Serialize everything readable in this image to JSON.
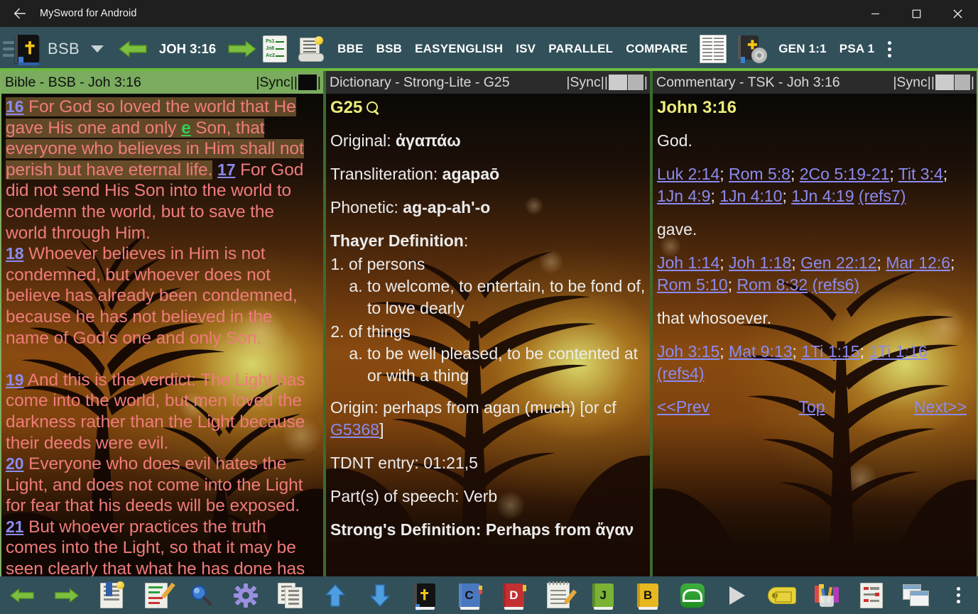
{
  "window": {
    "title": "MySword for Android",
    "back_icon": "back-arrow-icon",
    "minimize": "—",
    "maximize": "☐",
    "close": "✕"
  },
  "toolbar": {
    "module_label": "BSB",
    "dropdown_icon": "chevron-down-icon",
    "menu_icon": "hamburger-icon",
    "bible_icon": "bible-book-icon",
    "prev_icon": "left-green-arrow-icon",
    "next_icon": "right-green-arrow-icon",
    "reference": "JOH 3:16",
    "reading_plan_icon": "reading-plan-icon",
    "plan_rows": [
      {
        "label": "Ps1"
      },
      {
        "label": "Jn8"
      },
      {
        "label": "Ac2"
      }
    ],
    "cross_ref_icon": "linked-note-icon",
    "versions": [
      "BBE",
      "BSB",
      "EASYENGLISH",
      "ISV",
      "PARALLEL",
      "COMPARE"
    ],
    "parallel_view_icon": "parallel-columns-icon",
    "module_settings_icon": "book-gear-icon",
    "bookmark_left": "GEN 1:1",
    "bookmark_right": "PSA 1",
    "overflow_icon": "kebab-menu-icon"
  },
  "panels": {
    "bible": {
      "header_title": "Bible - BSB - Joh 3:16",
      "header_sync": "|Sync||",
      "header_sync_end": "|",
      "verses": [
        {
          "num": "16",
          "text": "For God so loved the world that He gave His one and only ",
          "strongs": "e",
          "text2": " Son, that everyone who believes in Him shall not perish but have eternal life.",
          "highlighted": true
        },
        {
          "num": "17",
          "text": "For God did not send His Son into the world to condemn the world, but to save the world through Him.",
          "highlighted": false
        },
        {
          "num": "18",
          "text": "Whoever believes in Him is not condemned, but whoever does not believe has already been condemned, because he has not believed in the name of God’s one and only Son.",
          "highlighted": false
        },
        {
          "num": "19",
          "text": "And this is the verdict: The Light has come into the world, but men loved the darkness rather than the Light because their deeds were evil.",
          "highlighted": false
        },
        {
          "num": "20",
          "text": "Everyone who does evil hates the Light, and does not come into the Light for fear that his deeds will be exposed.",
          "highlighted": false
        },
        {
          "num": "21",
          "text": "But whoever practices the truth comes into the Light, so that it may be seen clearly that what he has done has",
          "highlighted": false
        }
      ]
    },
    "dictionary": {
      "header_title": "Dictionary - Strong-Lite - G25",
      "header_sync": "|Sync||",
      "header_sync_end": "|",
      "entry_title": "G25",
      "search_icon": "magnifier-icon",
      "original_label": "Original:",
      "original_value": "ἀγαπάω",
      "translit_label": "Transliteration:",
      "translit_value": "agapaō",
      "phonetic_label": "Phonetic:",
      "phonetic_value": "ag-ap-ah'-o",
      "thayer_label": "Thayer Definition",
      "thayer_colon": ":",
      "thayer": [
        {
          "n": "of persons",
          "sub": [
            "to welcome, to entertain, to be fond of, to love dearly"
          ]
        },
        {
          "n": "of things",
          "sub": [
            "to be well pleased, to be contented at or with a thing"
          ]
        }
      ],
      "origin_pre": "Origin: perhaps from agan (much) [or cf ",
      "origin_link": "G5368",
      "origin_post": "]",
      "tdnt": "TDNT entry: 01:21,5",
      "pos": "Part(s) of speech: Verb",
      "strongs_def_cut": "Strong's Definition: Perhaps from ἄγαν"
    },
    "commentary": {
      "header_title": "Commentary - TSK - Joh 3:16",
      "header_sync": "|Sync||",
      "header_sync_end": "|",
      "entry_title": "John 3:16",
      "blocks": [
        {
          "phrase": "God.",
          "refs": [
            "Luk 2:14",
            "Rom 5:8",
            "2Co 5:19-21",
            "Tit 3:4",
            "1Jn 4:9",
            "1Jn 4:10",
            "1Jn 4:19"
          ],
          "refs_count": "(refs7)"
        },
        {
          "phrase": "gave.",
          "refs": [
            "Joh 1:14",
            "Joh 1:18",
            "Gen 22:12",
            "Mar 12:6",
            "Rom 5:10",
            "Rom 8:32"
          ],
          "refs_count": "(refs6)"
        },
        {
          "phrase": "that whosoever.",
          "refs": [
            "Joh 3:15",
            "Mat 9:13",
            "1Ti 1:15",
            "1Ti 1:16"
          ],
          "refs_count": "(refs4)"
        }
      ],
      "nav_prev": "<<Prev",
      "nav_top": "Top",
      "nav_next": "Next>>"
    }
  },
  "bottombar": {
    "items": [
      {
        "name": "back-button",
        "icon": "left-green-arrow-icon"
      },
      {
        "name": "forward-button",
        "icon": "right-green-arrow-icon"
      },
      {
        "name": "bookmark-button",
        "icon": "bookmark-page-icon"
      },
      {
        "name": "notes-button",
        "icon": "note-pencil-icon"
      },
      {
        "name": "search-button",
        "icon": "magnifier-icon"
      },
      {
        "name": "settings-button",
        "icon": "gear-icon"
      },
      {
        "name": "copy-button",
        "icon": "copy-pages-icon"
      },
      {
        "name": "scroll-up-button",
        "icon": "blue-up-arrow-icon"
      },
      {
        "name": "scroll-down-button",
        "icon": "blue-down-arrow-icon"
      },
      {
        "name": "bible-button",
        "icon": "bible-book-icon",
        "label": ""
      },
      {
        "name": "commentary-button",
        "icon": "commentary-book-icon",
        "label": "C"
      },
      {
        "name": "dictionary-button",
        "icon": "dictionary-book-icon",
        "label": "D"
      },
      {
        "name": "notepad-button",
        "icon": "notepad-pencil-icon"
      },
      {
        "name": "journal-button",
        "icon": "journal-book-icon",
        "label": "J"
      },
      {
        "name": "book-button",
        "icon": "book-book-icon",
        "label": "B"
      },
      {
        "name": "sync-button",
        "icon": "sync-circle-icon"
      },
      {
        "name": "play-button",
        "icon": "play-triangle-icon"
      },
      {
        "name": "highlight-button",
        "icon": "tag-label-icon"
      },
      {
        "name": "tools-button",
        "icon": "pen-cup-icon"
      },
      {
        "name": "layout-button",
        "icon": "outline-doc-icon"
      },
      {
        "name": "windows-button",
        "icon": "window-stack-icon"
      },
      {
        "name": "overflow-button",
        "icon": "kebab-menu-icon"
      }
    ]
  },
  "colors": {
    "toolbar_bg": "#31505a",
    "accent_green": "#6cbb3c",
    "verse_text": "#ef7b7b",
    "link": "#8b8bf0",
    "title_yellow": "#ecec7a",
    "panel_header_active": "#7aab5f"
  }
}
